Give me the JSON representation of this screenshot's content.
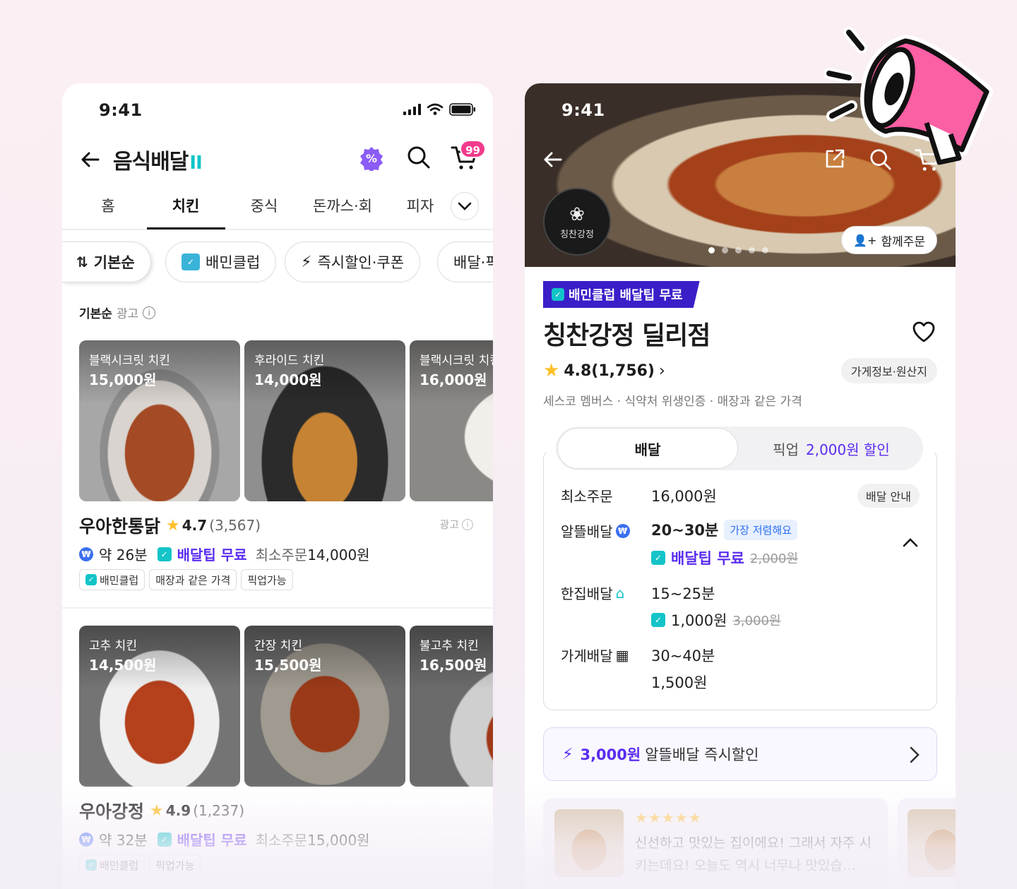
{
  "left": {
    "status_time": "9:41",
    "title": "음식배달",
    "cart_badge": "99",
    "tabs": [
      "홈",
      "치킨",
      "중식",
      "돈까스·회",
      "피자"
    ],
    "active_tab": "치킨",
    "chips": [
      "기본순",
      "배민클럽",
      "즉시할인·쿠폰",
      "배달·픽"
    ],
    "section": {
      "label": "기본순",
      "ad": "광고"
    },
    "store1": {
      "items": [
        {
          "name": "블랙시크릿 치킨",
          "price": "15,000원"
        },
        {
          "name": "후라이드 치킨",
          "price": "14,000원"
        },
        {
          "name": "블랙시크릿 치킨",
          "price": "16,000원"
        }
      ],
      "name": "우아한통닭",
      "rating": "4.7",
      "reviews": "(3,567)",
      "ad": "광고",
      "eta": "약 26분",
      "free": "배달팁 무료",
      "min_label": "최소주문",
      "min_value": "14,000원",
      "tags": [
        "배민클럽",
        "매장과 같은 가격",
        "픽업가능"
      ]
    },
    "store2": {
      "items": [
        {
          "name": "고추 치킨",
          "price": "14,500원"
        },
        {
          "name": "간장 치킨",
          "price": "15,500원"
        },
        {
          "name": "불고추 치킨",
          "price": "16,500원"
        }
      ],
      "name": "우아강정",
      "rating": "4.9",
      "reviews": "(1,237)",
      "eta": "약 32분",
      "free": "배달팁 무료",
      "min_label": "최소주문",
      "min_value": "15,000원",
      "tags": [
        "배민클럽",
        "픽업가능"
      ]
    }
  },
  "right": {
    "status_time": "9:41",
    "logo_text": "칭찬강정",
    "together": "함께주문",
    "club_banner": "배민클럽 배달팁 무료",
    "store_name": "칭찬강정 딜리점",
    "rating": "4.8(1,756)",
    "info_chip": "가게정보·원산지",
    "badges": "세스코 멤버스 · 식약처 위생인증 · 매장과 같은 가격",
    "tab_delivery": "배달",
    "tab_pickup": "픽업",
    "pickup_discount": "2,000원 할인",
    "min_order_label": "최소주문",
    "min_order_value": "16,000원",
    "guide": "배달 안내",
    "saver_label": "알뜰배달",
    "saver_time": "20~30분",
    "saver_cheap": "가장 저렴해요",
    "saver_fee": "배달팁 무료",
    "saver_fee_old": "2,000원",
    "single_label": "한집배달",
    "single_time": "15~25분",
    "single_fee": "1,000원",
    "single_fee_old": "3,000원",
    "store_label": "가게배달",
    "store_time": "30~40분",
    "store_fee": "1,500원",
    "discount_amount": "3,000원",
    "discount_text": "알뜰배달 즉시할인",
    "review_stars": "★★★★★",
    "review_text": "신선하고 맛있는 집이에요! 그래서 자주 시키는데요! 오늘도 역시 너무나 맛있습…"
  },
  "colors": {
    "accent": "#5a2cf0",
    "club": "#3a1fc9",
    "badge": "#f23b8c",
    "mint": "#13c4c8"
  }
}
